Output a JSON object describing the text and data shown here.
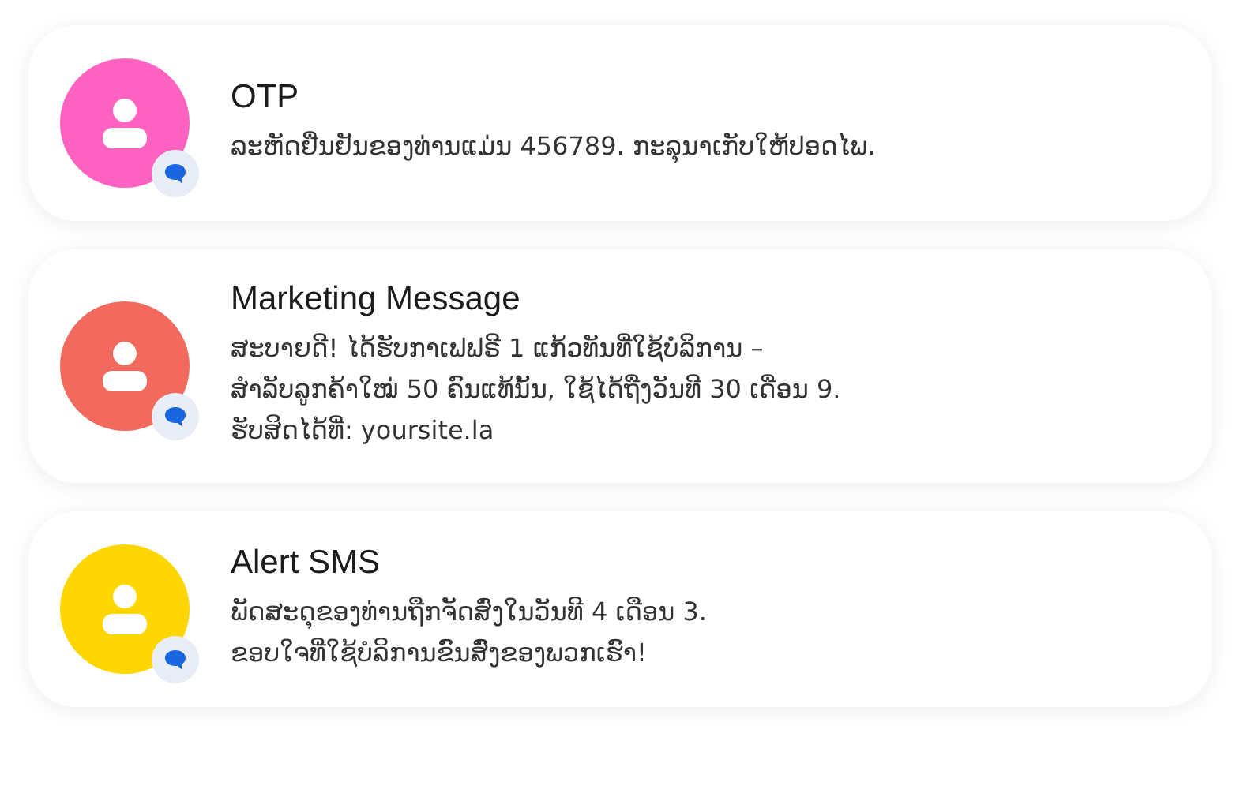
{
  "messages": [
    {
      "title": "OTP",
      "color": "#ff62c0",
      "lines": [
        "ລະຫັດຢືນຢັນຂອງທ່ານແມ່ນ 456789. ກະລຸນາເກັບໃຫ້ປອດໄພ."
      ]
    },
    {
      "title": "Marketing Message",
      "color": "#f2695e",
      "lines": [
        "ສະບາຍດີ! ໄດ້ຮັບກາເຟຟຣີ 1 ແກ້ວທັນທີ່ໃຊ້ບໍລິການ –",
        "ສຳລັບລູກຄ້າໃໝ່ 50 ຄົນແທ້ນັ້ນ, ໃຊ້ໄດ້ຖືງວັນທີ 30 ເດືອນ 9.",
        "ຮັບສິດໄດ້ທີ່: yoursite.la"
      ]
    },
    {
      "title": "Alert SMS",
      "color": "#ffd600",
      "lines": [
        "ພັດສະດຸຂອງທ່ານຖືກຈັດສົ່ງໃນວັນທີ 4 ເດືອນ 3.",
        "ຂອບໃຈທີ່ໃຊ້ບໍລິການຂົນສົ່ງຂອງພວກເຮົາ!"
      ]
    }
  ]
}
